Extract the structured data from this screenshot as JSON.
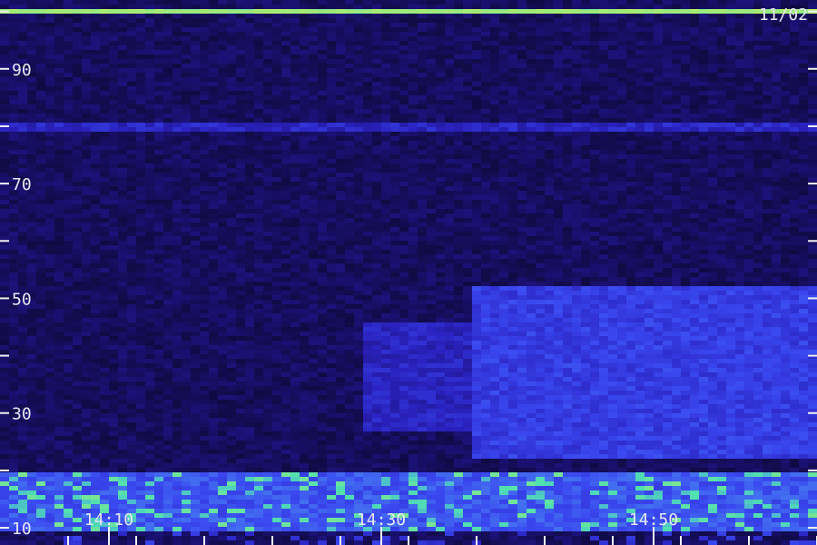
{
  "chart_data": {
    "type": "heatmap",
    "title": "",
    "xlabel": "",
    "ylabel": "",
    "date_label": "11/02",
    "x_range": [
      "14:02",
      "14:62"
    ],
    "x_major_ticks": [
      {
        "value": "14:10",
        "label": "14:10"
      },
      {
        "value": "14:30",
        "label": "14:30"
      },
      {
        "value": "14:50",
        "label": "14:50"
      }
    ],
    "x_minor_ticks": [
      "14:07",
      "14:12",
      "14:17",
      "14:22",
      "14:27",
      "14:32",
      "14:37",
      "14:42",
      "14:47",
      "14:52",
      "14:57",
      "14:62"
    ],
    "y_range": [
      7,
      102
    ],
    "y_ticks": [
      {
        "value": 10,
        "label": "10"
      },
      {
        "value": 20,
        "label": ""
      },
      {
        "value": 30,
        "label": "30"
      },
      {
        "value": 40,
        "label": ""
      },
      {
        "value": 50,
        "label": "50"
      },
      {
        "value": 60,
        "label": ""
      },
      {
        "value": 70,
        "label": "70"
      },
      {
        "value": 80,
        "label": ""
      },
      {
        "value": 90,
        "label": "90"
      },
      {
        "value": 100,
        "label": ""
      }
    ],
    "colormap": [
      "#0c0830",
      "#1a1070",
      "#2a22c0",
      "#3a48f0",
      "#4a90f0",
      "#50e0b0",
      "#c0f060"
    ],
    "features": [
      {
        "kind": "line",
        "y": 100,
        "x_start": "14:02",
        "x_end": "14:62",
        "intensity": 0.95
      },
      {
        "kind": "band",
        "y_from": 79,
        "y_to": 81,
        "x_start": "14:02",
        "x_end": "14:62",
        "intensity": 0.35
      },
      {
        "kind": "patch",
        "y_from": 27,
        "y_to": 46,
        "x_start": "14:29",
        "x_end": "14:62",
        "intensity": 0.45
      },
      {
        "kind": "patch",
        "y_from": 22,
        "y_to": 52,
        "x_start": "14:37",
        "x_end": "14:62",
        "intensity": 0.6
      },
      {
        "kind": "patch",
        "y_from": 9,
        "y_to": 20,
        "x_start": "14:02",
        "x_end": "14:62",
        "intensity": 0.7
      }
    ]
  }
}
